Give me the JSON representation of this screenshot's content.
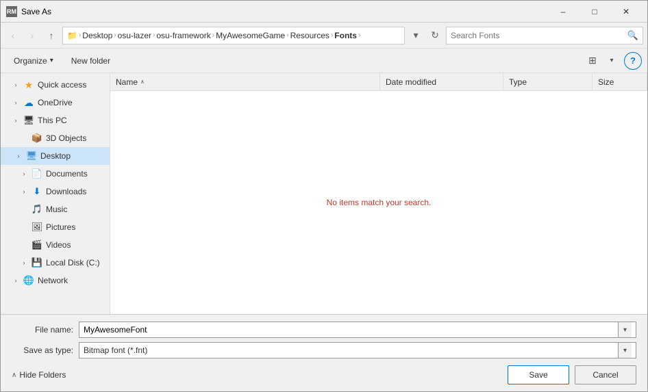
{
  "window": {
    "title": "Save As",
    "icon_label": "RM"
  },
  "titlebar": {
    "minimize": "–",
    "maximize": "□",
    "close": "✕"
  },
  "addressbar": {
    "back_tooltip": "Back",
    "forward_tooltip": "Forward",
    "up_tooltip": "Up",
    "refresh_tooltip": "Refresh",
    "breadcrumb": [
      {
        "label": "Desktop"
      },
      {
        "label": "osu-lazer"
      },
      {
        "label": "osu-framework"
      },
      {
        "label": "MyAwesomeGame"
      },
      {
        "label": "Resources"
      },
      {
        "label": "Fonts"
      }
    ],
    "search_placeholder": "Search Fonts",
    "search_value": ""
  },
  "toolbar": {
    "organize_label": "Organize",
    "organize_arrow": "▾",
    "new_folder_label": "New folder",
    "view_icon": "⊞",
    "view_arrow": "▾",
    "help_label": "?"
  },
  "sidebar": {
    "items": [
      {
        "id": "quick-access",
        "label": "Quick access",
        "icon": "★",
        "icon_class": "icon-quick-access",
        "indent": 0,
        "arrow": "›",
        "expanded": false
      },
      {
        "id": "onedrive",
        "label": "OneDrive",
        "icon": "☁",
        "icon_class": "icon-onedrive",
        "indent": 0,
        "arrow": "›",
        "expanded": false
      },
      {
        "id": "thispc",
        "label": "This PC",
        "icon": "💻",
        "icon_class": "icon-thispc",
        "indent": 0,
        "arrow": "›",
        "expanded": true
      },
      {
        "id": "3d-objects",
        "label": "3D Objects",
        "icon": "📦",
        "icon_class": "icon-folder",
        "indent": 1,
        "arrow": "",
        "expanded": false
      },
      {
        "id": "desktop",
        "label": "Desktop",
        "icon": "🖥",
        "icon_class": "icon-desktop",
        "indent": 1,
        "arrow": "›",
        "expanded": true,
        "selected": true
      },
      {
        "id": "documents",
        "label": "Documents",
        "icon": "📄",
        "icon_class": "icon-folder",
        "indent": 1,
        "arrow": "›",
        "expanded": false
      },
      {
        "id": "downloads",
        "label": "Downloads",
        "icon": "⬇",
        "icon_class": "icon-folder",
        "indent": 1,
        "arrow": "›",
        "expanded": false
      },
      {
        "id": "music",
        "label": "Music",
        "icon": "🎵",
        "icon_class": "icon-folder",
        "indent": 1,
        "arrow": "›",
        "expanded": false
      },
      {
        "id": "pictures",
        "label": "Pictures",
        "icon": "🖼",
        "icon_class": "icon-folder",
        "indent": 1,
        "arrow": "›",
        "expanded": false
      },
      {
        "id": "videos",
        "label": "Videos",
        "icon": "🎬",
        "icon_class": "icon-folder",
        "indent": 1,
        "arrow": "›",
        "expanded": false
      },
      {
        "id": "local-disk",
        "label": "Local Disk (C:)",
        "icon": "💾",
        "icon_class": "icon-folder",
        "indent": 1,
        "arrow": "›",
        "expanded": false
      },
      {
        "id": "network",
        "label": "Network",
        "icon": "🌐",
        "icon_class": "icon-network",
        "indent": 0,
        "arrow": "›",
        "expanded": false
      }
    ]
  },
  "filelist": {
    "columns": [
      {
        "id": "name",
        "label": "Name",
        "sort_arrow": "∧"
      },
      {
        "id": "date",
        "label": "Date modified"
      },
      {
        "id": "type",
        "label": "Type"
      },
      {
        "id": "size",
        "label": "Size"
      }
    ],
    "empty_message": "No items match your search."
  },
  "bottom": {
    "filename_label": "File name:",
    "filename_value": "MyAwesomeFont",
    "savetype_label": "Save as type:",
    "savetype_value": "Bitmap font (*.fnt)",
    "save_label": "Save",
    "cancel_label": "Cancel",
    "hide_folders_label": "Hide Folders",
    "hide_arrow": "∧"
  }
}
